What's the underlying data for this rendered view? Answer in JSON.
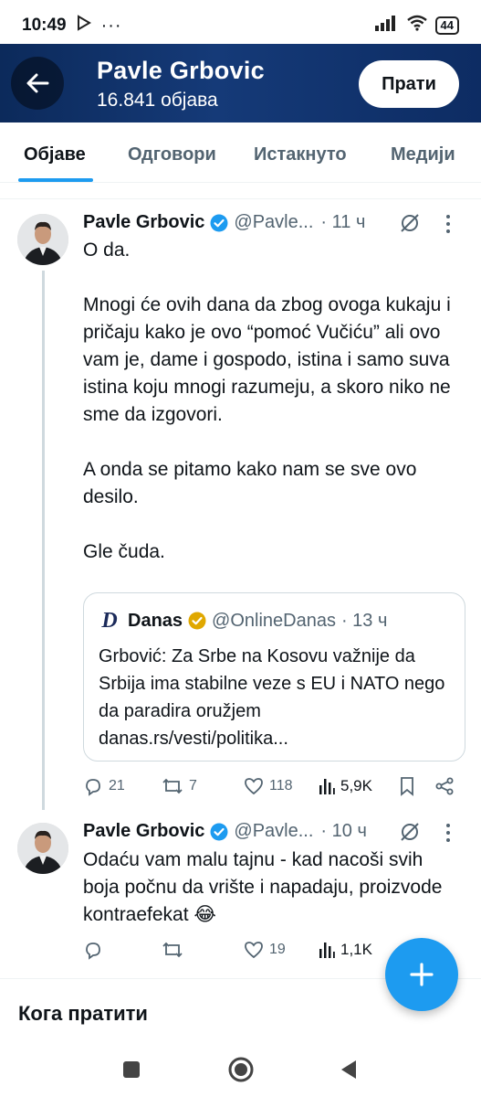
{
  "status_bar": {
    "time": "10:49",
    "battery": "44"
  },
  "header": {
    "name": "Pavle Grbovic",
    "post_count": "16.841 објава",
    "follow_label": "Прати"
  },
  "tabs": [
    {
      "label": "Објаве",
      "active": true
    },
    {
      "label": "Одговори",
      "active": false
    },
    {
      "label": "Истакнуто",
      "active": false
    },
    {
      "label": "Медији",
      "active": false
    }
  ],
  "tweets": [
    {
      "name": "Pavle Grbovic",
      "handle": "@Pavle...",
      "time": "· 11 ч",
      "text": "O da.\n\nMnogi će ovih dana da zbog ovoga kukaju i pričaju kako je ovo “pomoć Vučiću” ali ovo vam je, dame i gospodo, istina i samo suva istina koju mnogi razumeju, a skoro niko ne sme da izgovori.\n\nA onda se pitamo kako nam se sve ovo desilo.\n\nGle čuda.",
      "quote": {
        "logo": "D",
        "name": "Danas",
        "handle": "@OnlineDanas",
        "time": "· 13 ч",
        "text": "Grbović: Za Srbe na Kosovu važnije da Srbija ima stabilne veze s EU i NATO nego da paradira oružjem danas.rs/vesti/politika..."
      },
      "replies": "21",
      "reposts": "7",
      "likes": "118",
      "views": "5,9K"
    },
    {
      "name": "Pavle Grbovic",
      "handle": "@Pavle...",
      "time": "· 10 ч",
      "text": "Odaću vam malu tajnu - kad nacoši svih boja počnu da vrište i napadaju, proizvode kontraefekat 😂",
      "replies": "",
      "reposts": "",
      "likes": "19",
      "views": "1,1K"
    }
  ],
  "who_to_follow": "Кога пратити",
  "colors": {
    "accent": "#1d9bf0",
    "header_bg": "#153a78",
    "secondary_text": "#536471"
  }
}
